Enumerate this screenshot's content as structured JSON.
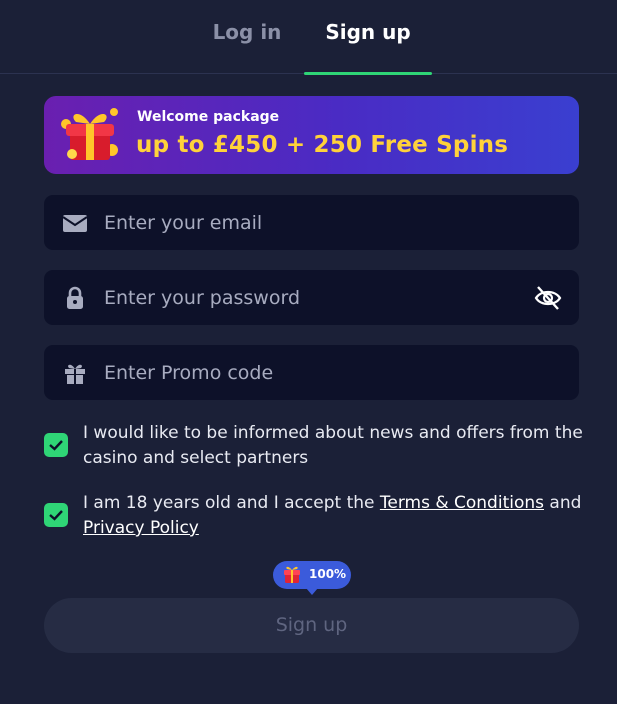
{
  "tabs": {
    "login": "Log in",
    "signup": "Sign up"
  },
  "banner": {
    "subtitle": "Welcome package",
    "headline": "up to £450 + 250 Free Spins"
  },
  "fields": {
    "email_placeholder": "Enter your email",
    "password_placeholder": "Enter your password",
    "promo_placeholder": "Enter Promo code"
  },
  "checks": {
    "news": "I would like to be informed about news and offers from the casino and select partners",
    "age_prefix": "I am 18 years old and I accept the ",
    "terms_link": "Terms & Conditions",
    "and": " and ",
    "privacy_link": "Privacy Policy"
  },
  "badge": {
    "text": "100%"
  },
  "submit_label": "Sign up",
  "colors": {
    "accent": "#2fd576",
    "headline": "#ffd23a",
    "badge": "#3b5bdb"
  },
  "icons": [
    "envelope-icon",
    "lock-icon",
    "eye-off-icon",
    "gift-icon",
    "check-icon",
    "gift-box-art"
  ]
}
